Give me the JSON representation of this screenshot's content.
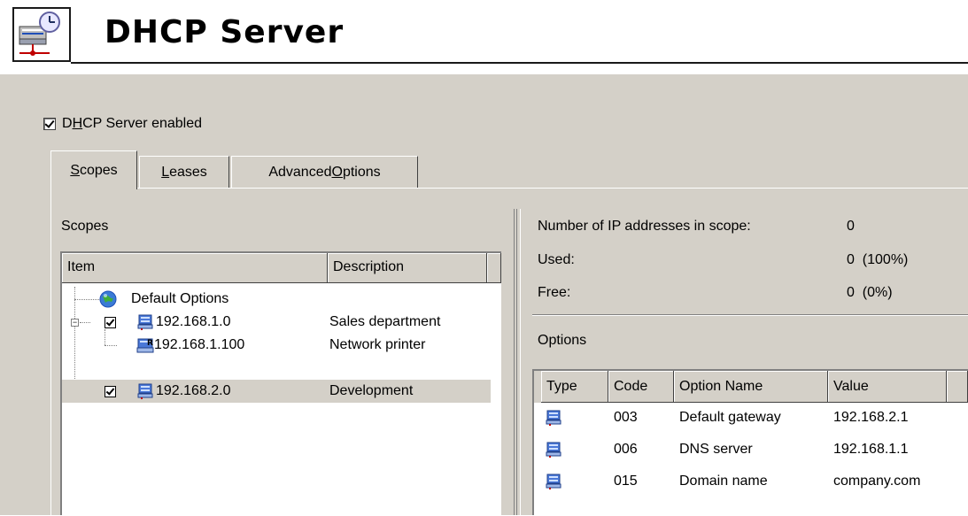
{
  "header": {
    "title": "DHCP Server"
  },
  "server": {
    "enabled": true,
    "enabled_label_pre": "D",
    "enabled_label_u": "H",
    "enabled_label_post": "CP Server enabled"
  },
  "tabs": [
    {
      "u": "S",
      "rest": "copes",
      "pre": ""
    },
    {
      "u": "L",
      "rest": "eases",
      "pre": ""
    },
    {
      "pre": "Advanced ",
      "u": "O",
      "rest": "ptions"
    }
  ],
  "scopes": {
    "label": "Scopes",
    "columns": [
      "Item",
      "Description"
    ],
    "items": [
      {
        "name": "Default Options",
        "description": "",
        "icon": "globe-icon"
      },
      {
        "name": "192.168.1.0",
        "description": "Sales department",
        "icon": "network-scope-icon",
        "checked": true
      },
      {
        "name": "192.168.1.100",
        "description": "Network printer",
        "icon": "reservation-icon"
      },
      {
        "name": "192.168.2.0",
        "description": "Development",
        "icon": "network-scope-icon",
        "checked": true
      }
    ]
  },
  "stats": {
    "total_label": "Number of IP addresses in scope:",
    "total_value": "0",
    "used_label": "Used:",
    "used_value": "0  (100%)",
    "free_label": "Free:",
    "free_value": "0  (0%)"
  },
  "options": {
    "label": "Options",
    "columns": [
      "Type",
      "Code",
      "Option Name",
      "Value"
    ],
    "rows": [
      {
        "code": "003",
        "name": "Default gateway",
        "value": "192.168.2.1"
      },
      {
        "code": "006",
        "name": "DNS server",
        "value": "192.168.1.1"
      },
      {
        "code": "015",
        "name": "Domain name",
        "value": "company.com"
      }
    ]
  },
  "colors": {
    "window_bg": "#d4d0c8",
    "selection_bg": "#d4d0c8",
    "accent_blue": "#1f4fb8"
  }
}
